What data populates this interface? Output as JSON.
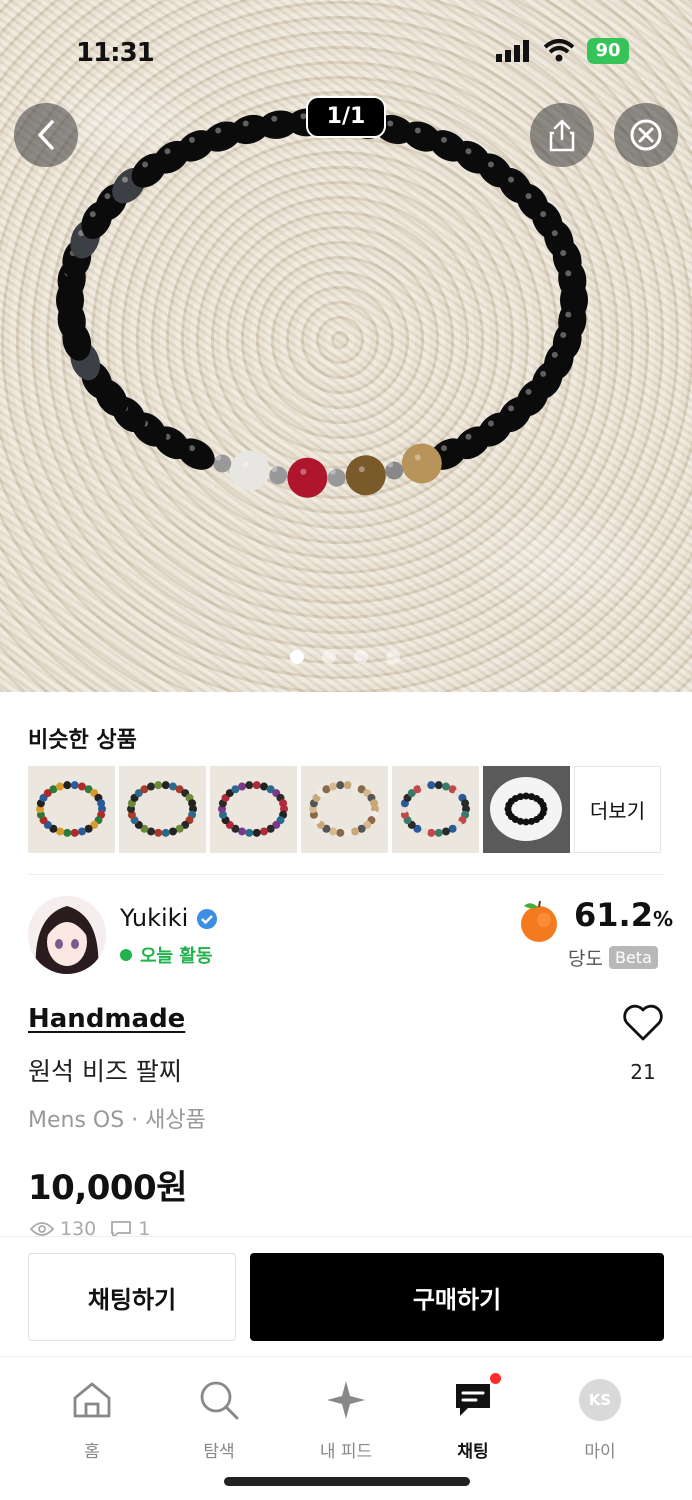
{
  "status_bar": {
    "time": "11:31",
    "battery": "90"
  },
  "top": {
    "image_counter": "1/1"
  },
  "similar": {
    "title": "비슷한 상품",
    "more_label": "더보기"
  },
  "seller": {
    "name": "Yukiki",
    "activity": "오늘 활동",
    "score": "61.2",
    "score_unit": "%",
    "score_label": "당도",
    "score_badge": "Beta"
  },
  "product": {
    "brand": "Handmade",
    "name": "원석 비즈 팔찌",
    "meta": "Mens OS · 새상품",
    "price": "10,000원",
    "likes": "21",
    "views": "130",
    "chats": "1"
  },
  "actions": {
    "chat_label": "채팅하기",
    "buy_label": "구매하기"
  },
  "tabs": [
    {
      "label": "홈",
      "icon": "home-icon"
    },
    {
      "label": "탐색",
      "icon": "search-icon"
    },
    {
      "label": "내 피드",
      "icon": "sparkle-icon"
    },
    {
      "label": "채팅",
      "icon": "chat-icon"
    },
    {
      "label": "마이",
      "icon": "profile-icon",
      "initials": "KS"
    }
  ],
  "colors": {
    "active_green": "#22b24c",
    "badge_red": "#ff2d2d",
    "buy_button": "#000000"
  }
}
